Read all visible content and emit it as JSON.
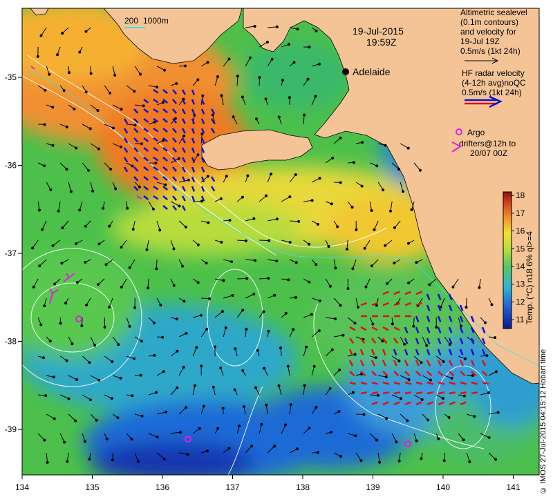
{
  "map": {
    "date": "19-Jul-2015",
    "time": "19:59Z",
    "city": "Adelaide",
    "isobath_legend": {
      "line1": "200",
      "line2": "1000m"
    },
    "lon_ticks": [
      "134",
      "135",
      "136",
      "137",
      "138",
      "139",
      "140",
      "141"
    ],
    "lat_ticks": [
      "-35",
      "-36",
      "-37",
      "-38",
      "-39"
    ],
    "legend_altimetric": {
      "lines": [
        "Altimetric sealevel",
        "(0.1m contours)",
        "and velocity for",
        "19-Jul 19Z",
        "0.5m/s (1kt 24h)"
      ]
    },
    "legend_hf": {
      "lines": [
        "HF radar velocity",
        "(4-12h avg)noQC",
        "0.5m/s (1kt 24h)"
      ]
    },
    "legend_argo": {
      "lines": [
        "Argo",
        "drifters@12h to",
        "20/07 00Z"
      ]
    },
    "colorbar": {
      "label": "Temp. (°C) n18 6% ql>=4",
      "ticks": [
        "18",
        "17",
        "16",
        "15",
        "14",
        "13",
        "12",
        "11"
      ],
      "range": [
        10.5,
        18.2
      ]
    },
    "copyright": "© IMOS 27-Jul-2015 04:15:12 Hobart time",
    "colors": {
      "land": "#f4c496",
      "ocean_warm": "#f08a2a",
      "ocean_mid": "#5cc84a",
      "ocean_cool": "#2f8bd0",
      "radar_blue": "#1010d0",
      "radar_red": "#e01010",
      "argo": "#e020e0"
    }
  }
}
